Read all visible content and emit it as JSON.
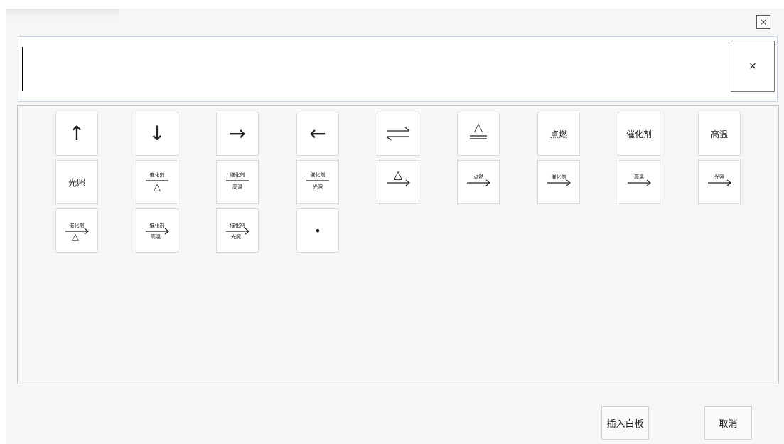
{
  "dialog": {
    "close_label": "×"
  },
  "input": {
    "value": "",
    "clear_label": "×"
  },
  "palette": {
    "symbols": [
      {
        "name": "up-arrow",
        "kind": "glyph",
        "char": "↑"
      },
      {
        "name": "down-arrow",
        "kind": "glyph",
        "char": "↓"
      },
      {
        "name": "right-arrow",
        "kind": "glyph",
        "char": "→"
      },
      {
        "name": "left-arrow",
        "kind": "glyph",
        "char": "←"
      },
      {
        "name": "reversible-arrow",
        "kind": "equilibrium"
      },
      {
        "name": "heat-equals",
        "kind": "over-equals",
        "top": "△"
      },
      {
        "name": "ignite",
        "kind": "text",
        "text": "点燃"
      },
      {
        "name": "catalyst",
        "kind": "text",
        "text": "催化剂"
      },
      {
        "name": "high-temp",
        "kind": "text",
        "text": "高温"
      },
      {
        "name": "light",
        "kind": "text",
        "text": "光照"
      },
      {
        "name": "catalyst-heat-equals",
        "kind": "fraction",
        "top": "催化剂",
        "bottom": "△"
      },
      {
        "name": "catalyst-hightemp-equals",
        "kind": "fraction",
        "top": "催化剂",
        "bottom": "高温"
      },
      {
        "name": "catalyst-light-equals",
        "kind": "fraction",
        "top": "催化剂",
        "bottom": "光照"
      },
      {
        "name": "heat-arrow",
        "kind": "arrow",
        "top": "△",
        "bottom": ""
      },
      {
        "name": "ignite-arrow",
        "kind": "arrow",
        "top": "点燃",
        "bottom": ""
      },
      {
        "name": "catalyst-arrow",
        "kind": "arrow",
        "top": "催化剂",
        "bottom": ""
      },
      {
        "name": "hightemp-arrow",
        "kind": "arrow",
        "top": "高温",
        "bottom": ""
      },
      {
        "name": "light-arrow",
        "kind": "arrow",
        "top": "光照",
        "bottom": ""
      },
      {
        "name": "catalyst-heat-arrow",
        "kind": "arrow",
        "top": "催化剂",
        "bottom": "△"
      },
      {
        "name": "catalyst-hightemp-arrow",
        "kind": "arrow",
        "top": "催化剂",
        "bottom": "高温"
      },
      {
        "name": "catalyst-light-arrow",
        "kind": "arrow",
        "top": "催化剂",
        "bottom": "光照"
      },
      {
        "name": "dot",
        "kind": "glyph",
        "char": "•"
      }
    ]
  },
  "footer": {
    "insert_label": "插入白板",
    "cancel_label": "取消"
  }
}
